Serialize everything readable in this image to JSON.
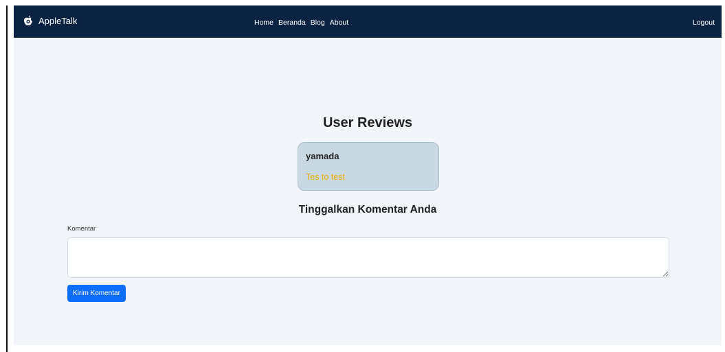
{
  "navbar": {
    "brand": "AppleTalk",
    "links": [
      "Home",
      "Beranda",
      "Blog",
      "About"
    ],
    "logout": "Logout",
    "background": "#0a2342"
  },
  "reviews": {
    "title": "User Reviews",
    "items": [
      {
        "user": "yamada",
        "text": "Tes to test"
      }
    ]
  },
  "comment_form": {
    "title": "Tinggalkan Komentar Anda",
    "label": "Komentar",
    "value": "",
    "placeholder": "",
    "submit_label": "Kirim Komentar",
    "submit_color": "#0d6efd"
  },
  "icons": {
    "brand": "apple-icon"
  }
}
